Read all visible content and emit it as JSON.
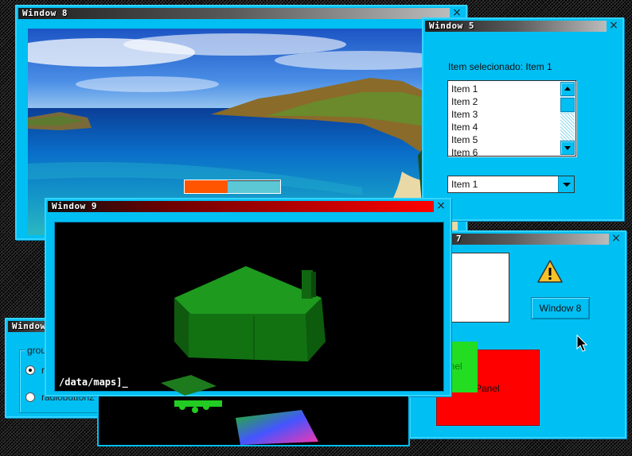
{
  "windows": {
    "w8": {
      "title": "Window 8",
      "close": "×",
      "progress": 0.45
    },
    "w5": {
      "title": "Window 5",
      "close": "×",
      "selected_label": "Item selecionado: Item 1",
      "list_items": [
        "Item 1",
        "Item 2",
        "Item 3",
        "Item 4",
        "Item 5",
        "Item 6"
      ],
      "dropdown_value": "Item 1"
    },
    "w9": {
      "title": "Window 9",
      "close": "×",
      "console_text": "/data/maps]_"
    },
    "w7": {
      "title": "Window 7",
      "close": "×",
      "button_label": "Window 8",
      "panel_green": "Panel",
      "panel_red": "Panel"
    },
    "w4": {
      "title": "Window 4",
      "groupbox_label": "groupbox1",
      "radio1": "radiobutton1",
      "radio2": "radiobutton2"
    }
  },
  "icons": {
    "close": "close-icon",
    "up": "scroll-up-icon",
    "down": "scroll-down-icon",
    "warning": "warning-icon",
    "cursor": "mouse-pointer-icon"
  },
  "colors": {
    "window_bg": "#00bff3",
    "window_border": "#33d4ff",
    "progress_fill": "#ff5500",
    "panel_red": "#ff0000",
    "panel_green": "#22dd22"
  }
}
